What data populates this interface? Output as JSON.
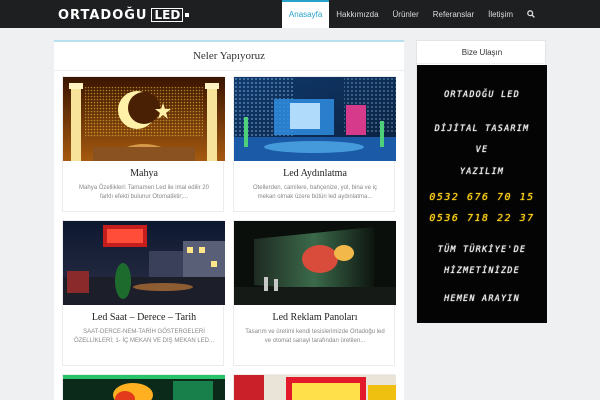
{
  "header": {
    "logo_text": "ORTADOĞU",
    "logo_led": "LED",
    "nav": [
      {
        "label": "Anasayfa",
        "active": true
      },
      {
        "label": "Hakkımızda",
        "active": false
      },
      {
        "label": "Ürünler",
        "active": false
      },
      {
        "label": "Referanslar",
        "active": false
      },
      {
        "label": "İletişim",
        "active": false
      }
    ],
    "search_icon": "search-icon"
  },
  "main": {
    "title": "Neler Yapıyoruz",
    "cards": [
      {
        "title": "Mahya",
        "text": "Mahya Özellikleri: Tamamen Led ile imal edilir 20 farklı efekti bulunur Otomatiktir;..."
      },
      {
        "title": "Led Aydınlatma",
        "text": "Otellerden, camilere, bahçenize, yol, bina ve iç mekan olmak üzere bütün led aydınlatma..."
      },
      {
        "title": "Led Saat – Derece – Tarih",
        "text": "SAAT-DERCE-NEM-TARİH GÖSTERGELERİ ÖZELLİKLERİ; 1- İÇ MEKAN VE DIŞ MEKAN LED..."
      },
      {
        "title": "Led Reklam Panoları",
        "text": "Tasarım ve üretimi kendi tesislerimizde Ortadoğu led ve otomat sanayi tarafından üretilen..."
      },
      {
        "title": "",
        "text": ""
      },
      {
        "title": "",
        "text": ""
      }
    ]
  },
  "sidebar": {
    "title": "Bize Ulaşın",
    "board": {
      "line1": "ORTADOĞU LED",
      "line2": "DİJİTAL TASARIM",
      "line3": "VE",
      "line4": "YAZILIM",
      "phone1": "0532 676 70 15",
      "phone2": "0536 718 22 37",
      "line5": "TÜM TÜRKİYE'DE",
      "line6": "HİZMETİNİZDE",
      "line7": "HEMEN ARAYIN"
    }
  },
  "colors": {
    "accent": "#27a1c9",
    "topbar": "#1d1f21",
    "led_yellow": "#ffd21e"
  }
}
